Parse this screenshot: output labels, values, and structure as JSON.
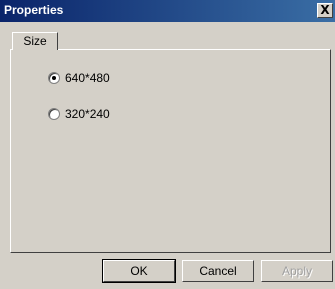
{
  "window": {
    "title": "Properties",
    "close_label": "X"
  },
  "tabs": [
    {
      "label": "Size"
    }
  ],
  "size_options": [
    {
      "label": "640*480",
      "selected": true
    },
    {
      "label": "320*240",
      "selected": false
    }
  ],
  "buttons": {
    "ok": "OK",
    "cancel": "Cancel",
    "apply": "Apply"
  }
}
